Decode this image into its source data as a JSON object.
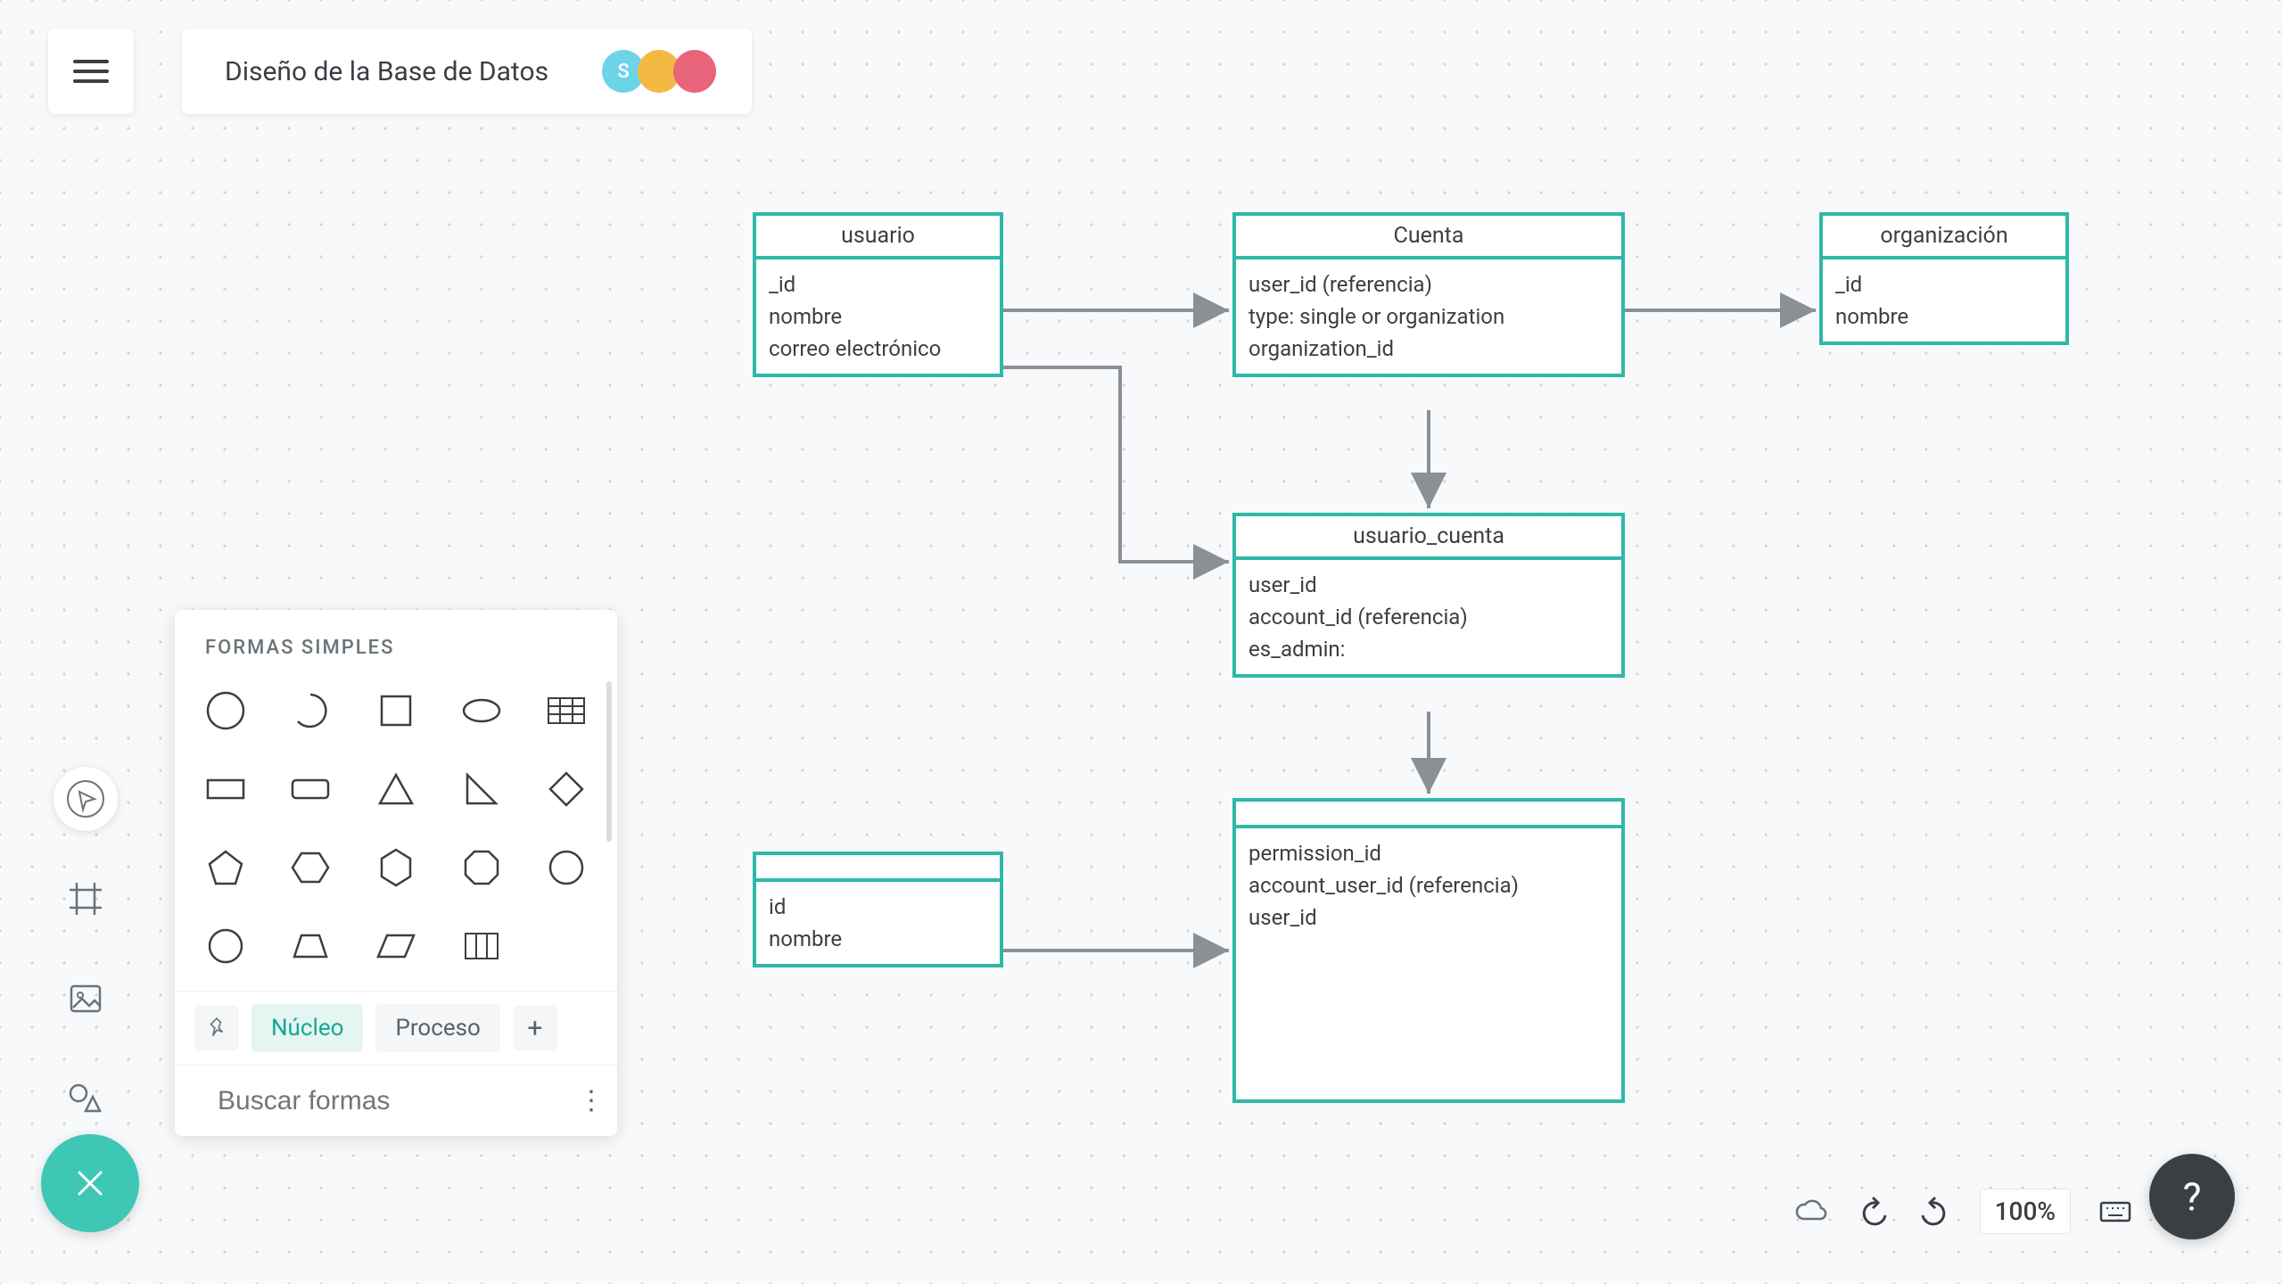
{
  "header": {
    "title": "Diseño de la Base de Datos",
    "avatars": [
      {
        "letter": "S",
        "bg": "#6dd4e8"
      },
      {
        "letter": "",
        "bg": "#f4b942"
      },
      {
        "letter": "",
        "bg": "#e8647a"
      }
    ]
  },
  "shapes_panel": {
    "heading": "FORMAS SIMPLES",
    "tabs": {
      "active": "Núcleo",
      "inactive": "Proceso"
    },
    "search_placeholder": "Buscar formas",
    "shapes": [
      "circle",
      "arc",
      "square",
      "ellipse",
      "table",
      "rectangle",
      "rounded-rect",
      "triangle",
      "right-triangle",
      "diamond",
      "pentagon",
      "hexagon",
      "hex-vert",
      "octagon",
      "nonagon",
      "decagon",
      "trapezoid",
      "parallelogram",
      "grid"
    ]
  },
  "entities": {
    "usuario": {
      "title": "usuario",
      "rows": [
        "_id",
        "nombre",
        "correo electrónico"
      ]
    },
    "cuenta": {
      "title": "Cuenta",
      "rows": [
        "user_id      (referencia)",
        "type:    single    or   organization",
        "organization_id"
      ]
    },
    "organizacion": {
      "title": "organización",
      "rows": [
        "_id",
        "nombre"
      ]
    },
    "usuario_cuenta": {
      "title": "usuario_cuenta",
      "rows": [
        "user_id",
        "account_id   (referencia)",
        " es_admin:"
      ]
    },
    "permiso": {
      "title": "",
      "rows": [
        "id",
        "nombre"
      ]
    },
    "permiso_usuario": {
      "title": "",
      "rows": [
        "permission_id",
        "account_user_id  (referencia)",
        "user_id"
      ]
    }
  },
  "footer": {
    "zoom": "100%"
  }
}
